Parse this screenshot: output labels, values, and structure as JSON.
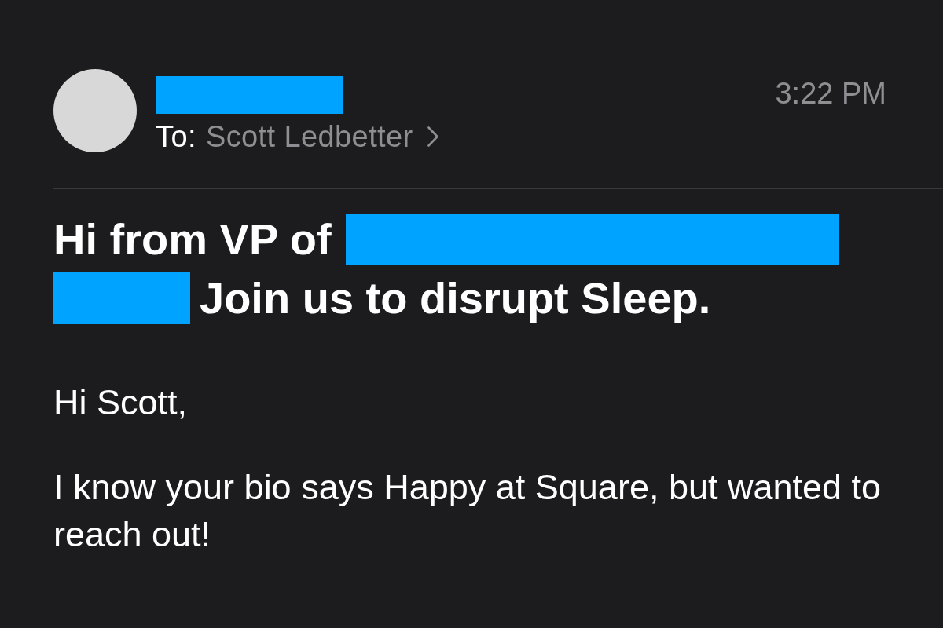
{
  "header": {
    "sender": {
      "kind": "redacted"
    },
    "recipient_label": "To:",
    "recipient": "Scott Ledbetter",
    "time": "3:22 PM"
  },
  "subject": {
    "lines": [
      {
        "parts": [
          {
            "kind": "text",
            "text": "Hi from VP of"
          },
          {
            "kind": "redaction"
          }
        ]
      },
      {
        "parts": [
          {
            "kind": "redaction"
          },
          {
            "kind": "text",
            "text": "Join us to disrupt Sleep."
          }
        ]
      }
    ]
  },
  "body": {
    "paragraphs": [
      "Hi Scott,",
      "I know your bio says Happy at Square, but wanted to reach out!"
    ]
  }
}
